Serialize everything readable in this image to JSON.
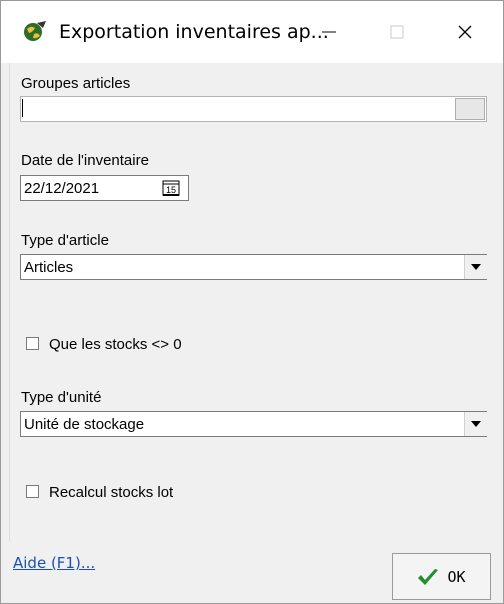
{
  "window": {
    "title": "Exportation inventaires ap...",
    "icons": {
      "app": "app-globe-icon",
      "minimize": "minimize-icon",
      "maximize": "maximize-icon",
      "close": "close-icon"
    }
  },
  "form": {
    "groups_label": "Groupes articles",
    "groups_value": "",
    "date_label": "Date de l'inventaire",
    "date_value": "22/12/2021",
    "calendar_glyph": "15",
    "type_article_label": "Type d'article",
    "type_article_value": "Articles",
    "stocks_checkbox_label": "Que les stocks <> 0",
    "stocks_checked": false,
    "type_unite_label": "Type d'unité",
    "type_unite_value": "Unité de stockage",
    "recalcul_checkbox_label": "Recalcul stocks lot",
    "recalcul_checked": false
  },
  "footer": {
    "help_label": "Aide (F1)...",
    "ok_label": "OK"
  },
  "colors": {
    "accent_link": "#1a4fb5",
    "ok_check": "#1f8f2f"
  }
}
